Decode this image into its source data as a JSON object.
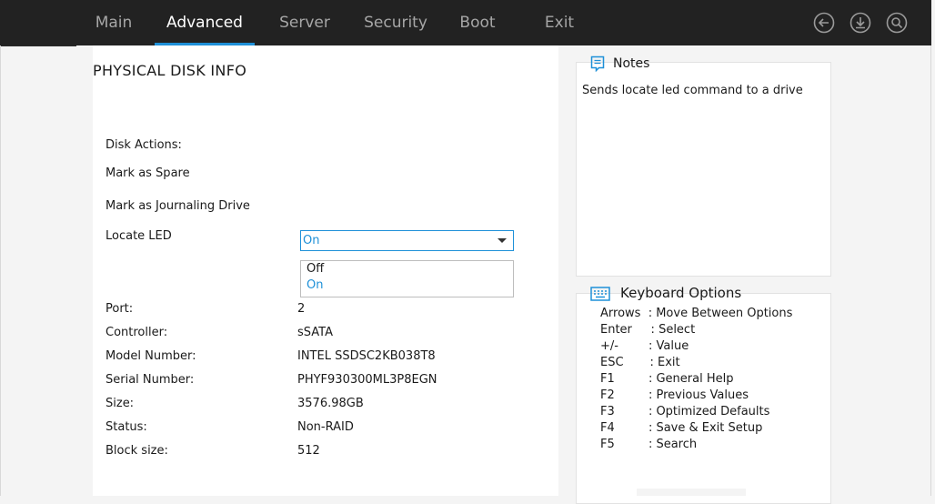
{
  "nav": {
    "tabs": [
      {
        "label": "Main"
      },
      {
        "label": "Advanced"
      },
      {
        "label": "Server"
      },
      {
        "label": "Security"
      },
      {
        "label": "Boot"
      },
      {
        "label": "Exit"
      }
    ],
    "active_tab": "Advanced",
    "accent_color": "#1e90d8",
    "icons": [
      "back-icon",
      "download-icon",
      "search-icon"
    ]
  },
  "page": {
    "title": "PHYSICAL DISK INFO",
    "disk_actions_label": "Disk Actions:",
    "mark_spare_label": "Mark as Spare",
    "mark_journal_label": "Mark as Journaling Drive",
    "locate_led": {
      "label": "Locate LED",
      "selected": "On",
      "options": [
        "Off",
        "On"
      ]
    },
    "info": [
      {
        "label": "Port:",
        "value": "2"
      },
      {
        "label": "Controller:",
        "value": "sSATA"
      },
      {
        "label": "Model Number:",
        "value": "INTEL SSDSC2KB038T8"
      },
      {
        "label": "Serial Number:",
        "value": "PHYF930300ML3P8EGN"
      },
      {
        "label": "Size:",
        "value": "3576.98GB"
      },
      {
        "label": "Status:",
        "value": "Non-RAID"
      },
      {
        "label": "Block size:",
        "value": "512"
      }
    ]
  },
  "notes": {
    "title": "Notes",
    "text": "Sends locate led command to a drive"
  },
  "keyboard": {
    "title": "Keyboard Options",
    "lines": [
      "Arrows  : Move Between Options",
      "Enter     : Select",
      "+/-        : Value",
      "ESC       : Exit",
      "F1         : General Help",
      "F2         : Previous Values",
      "F3         : Optimized Defaults",
      "F4         : Save & Exit Setup",
      "F5         : Search"
    ]
  }
}
